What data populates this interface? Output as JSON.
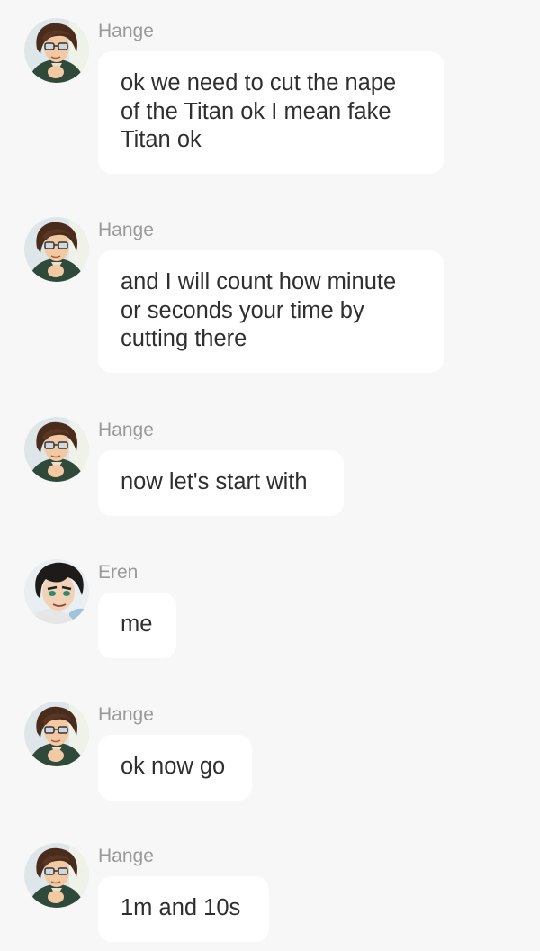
{
  "messages": [
    {
      "sender": "Hange",
      "avatar_icon": "hange-avatar-icon",
      "text": "ok we need to cut the nape of the Titan ok I mean fake Titan ok"
    },
    {
      "sender": "Hange",
      "avatar_icon": "hange-avatar-icon",
      "text": "and I will count how minute or seconds your time by cutting there"
    },
    {
      "sender": "Hange",
      "avatar_icon": "hange-avatar-icon",
      "text": "now let's start with"
    },
    {
      "sender": "Eren",
      "avatar_icon": "eren-avatar-icon",
      "text": "me"
    },
    {
      "sender": "Hange",
      "avatar_icon": "hange-avatar-icon",
      "text": "ok now go"
    },
    {
      "sender": "Hange",
      "avatar_icon": "hange-avatar-icon",
      "text": "1m and 10s"
    }
  ],
  "colors": {
    "background": "#f7f7f7",
    "bubble": "#ffffff",
    "sender_name": "#9a9a9a",
    "message_text": "#2f2f2f"
  }
}
